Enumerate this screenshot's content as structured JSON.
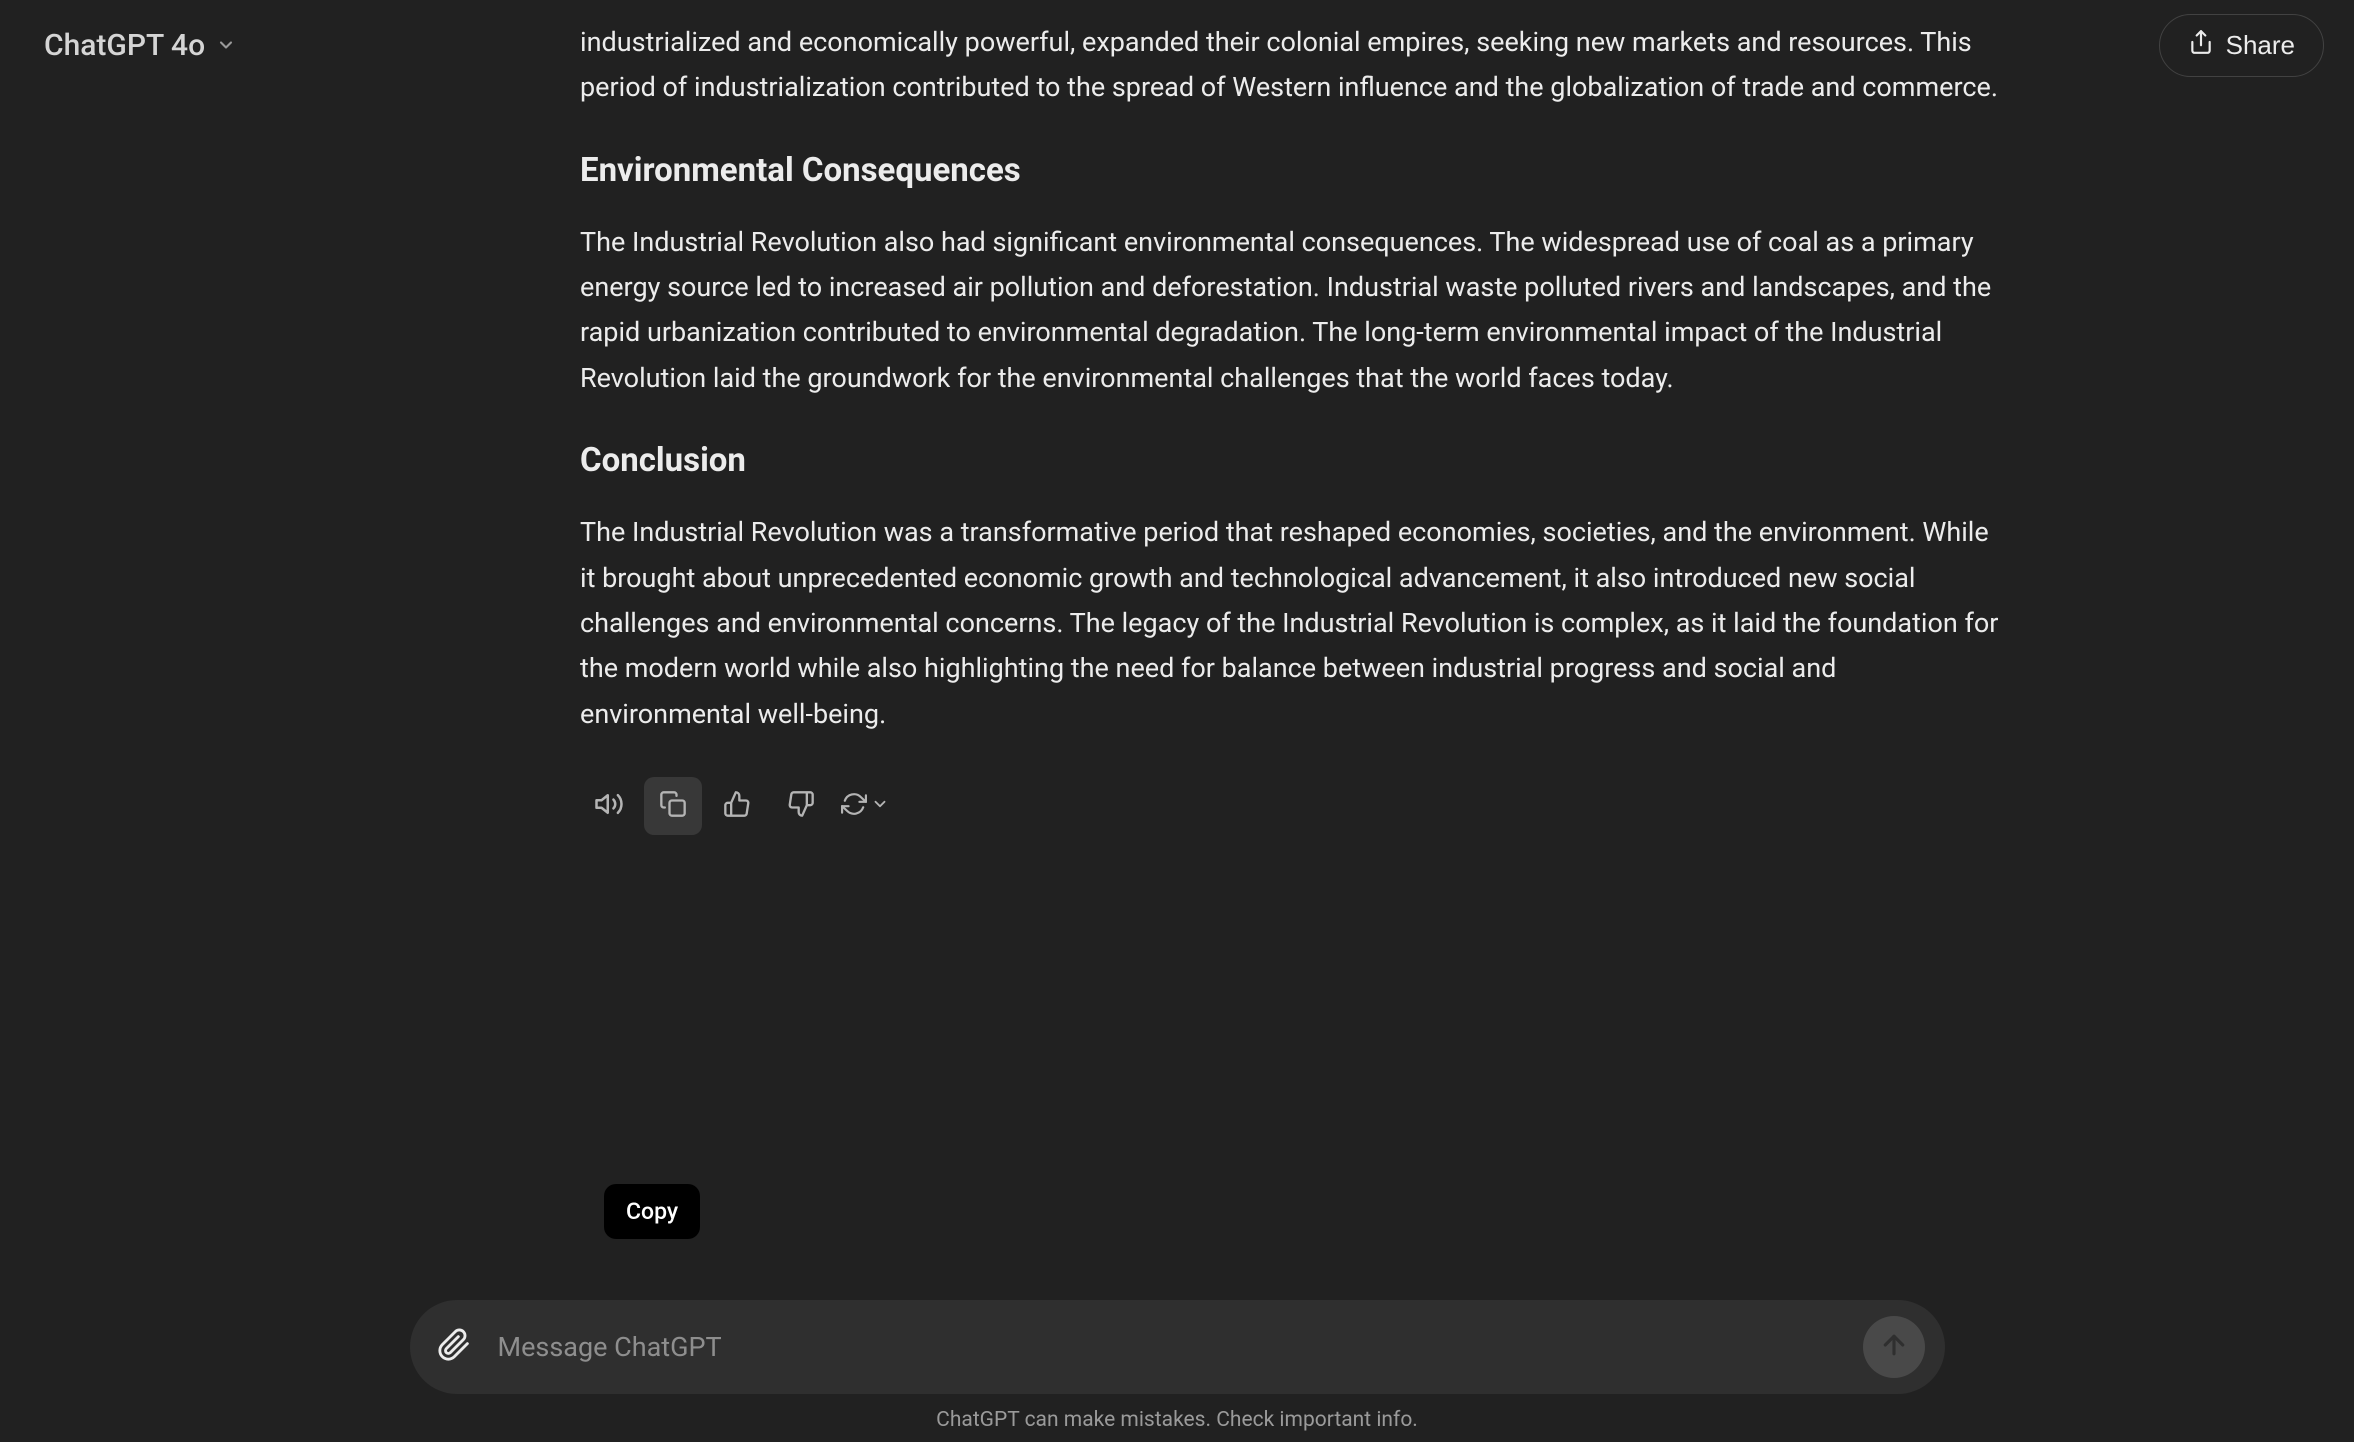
{
  "header": {
    "model_name": "ChatGPT 4o",
    "share_label": "Share"
  },
  "content": {
    "partial_paragraph": "industrialized and economically powerful, expanded their colonial empires, seeking new markets and resources. This period of industrialization contributed to the spread of Western influence and the globalization of trade and commerce.",
    "sections": [
      {
        "heading": "Environmental Consequences",
        "body": "The Industrial Revolution also had significant environmental consequences. The widespread use of coal as a primary energy source led to increased air pollution and deforestation. Industrial waste polluted rivers and landscapes, and the rapid urbanization contributed to environmental degradation. The long-term environmental impact of the Industrial Revolution laid the groundwork for the environmental challenges that the world faces today."
      },
      {
        "heading": "Conclusion",
        "body": "The Industrial Revolution was a transformative period that reshaped economies, societies, and the environment. While it brought about unprecedented economic growth and technological advancement, it also introduced new social challenges and environmental concerns. The legacy of the Industrial Revolution is complex, as it laid the foundation for the modern world while also highlighting the need for balance between industrial progress and social and environmental well-being."
      }
    ]
  },
  "actions": {
    "tooltip_copy": "Copy"
  },
  "input": {
    "placeholder": "Message ChatGPT"
  },
  "footer": {
    "disclaimer": "ChatGPT can make mistakes. Check important info."
  }
}
